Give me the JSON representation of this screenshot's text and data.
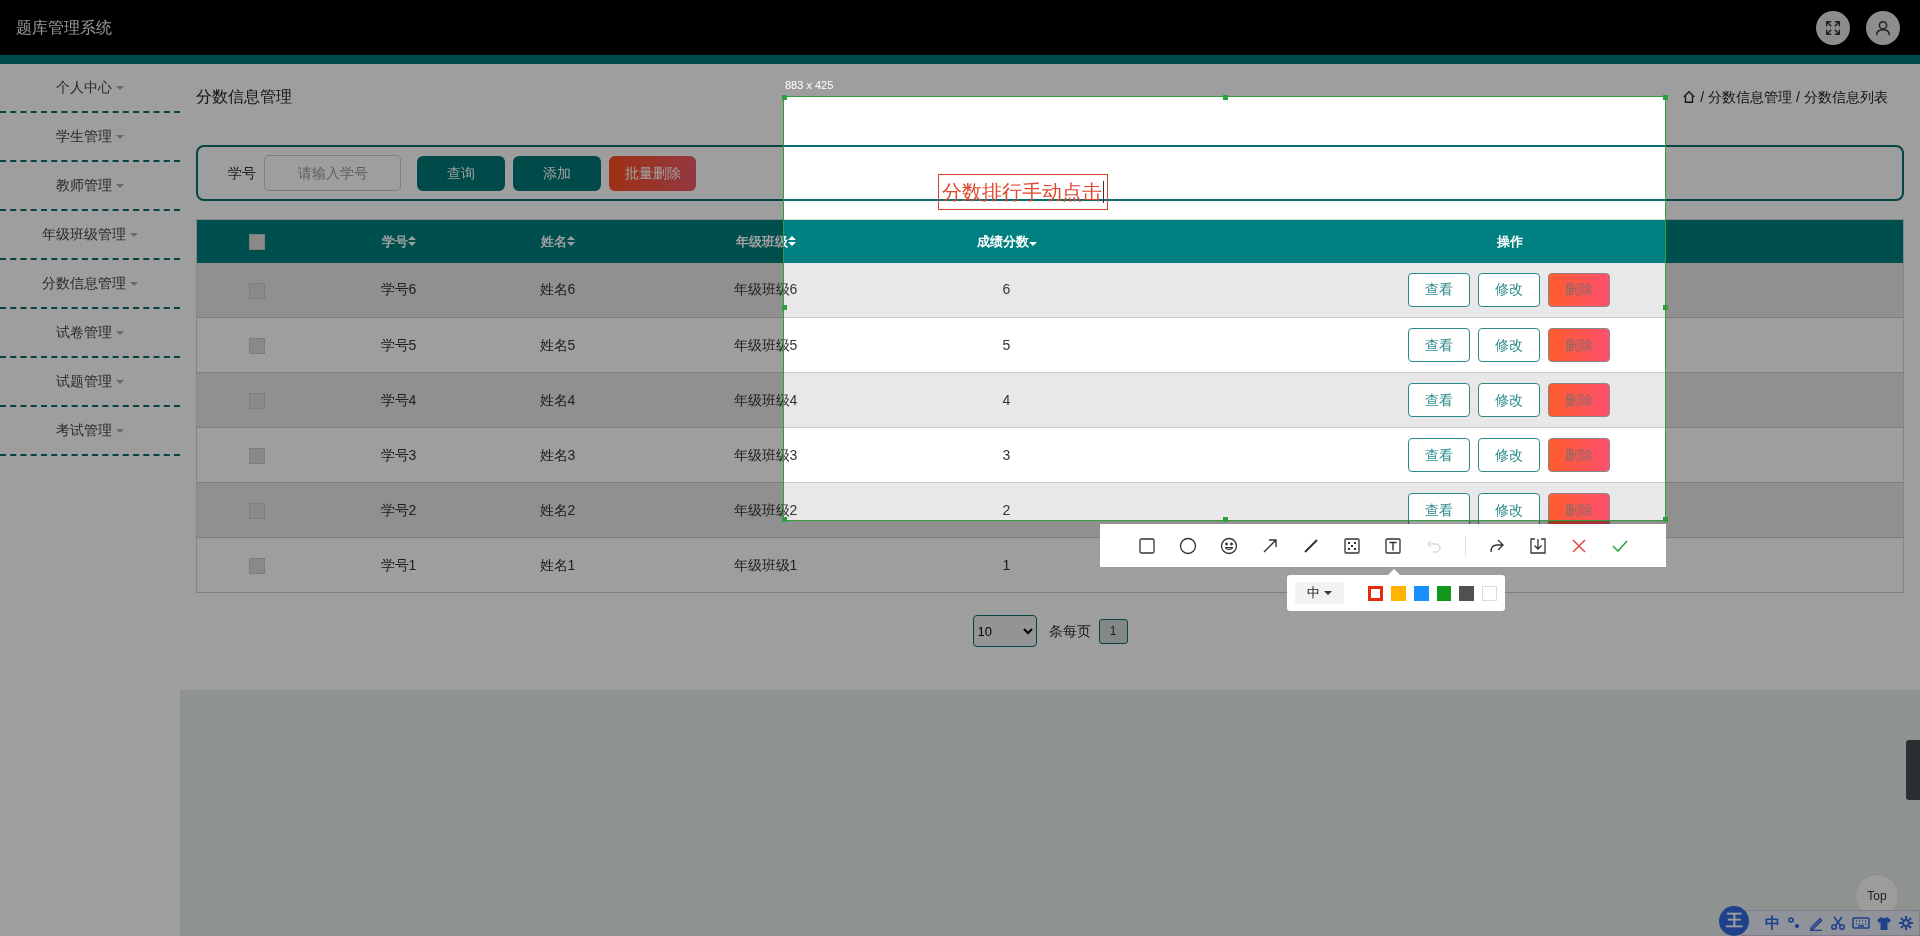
{
  "app": {
    "title": "题库管理系统"
  },
  "sidebar": {
    "items": [
      {
        "label": "个人中心"
      },
      {
        "label": "学生管理"
      },
      {
        "label": "教师管理"
      },
      {
        "label": "年级班级管理"
      },
      {
        "label": "分数信息管理"
      },
      {
        "label": "试卷管理"
      },
      {
        "label": "试题管理"
      },
      {
        "label": "考试管理"
      }
    ]
  },
  "page": {
    "title": "分数信息管理",
    "separator": "/",
    "breadcrumb": [
      "分数信息管理",
      "分数信息列表"
    ]
  },
  "search": {
    "label": "学号",
    "placeholder": "请输入学号",
    "buttons": [
      {
        "label": "查询",
        "kind": "primary"
      },
      {
        "label": "添加",
        "kind": "primary"
      },
      {
        "label": "批量删除",
        "kind": "danger"
      }
    ]
  },
  "table": {
    "select_all": {
      "checked": false
    },
    "columns": [
      {
        "label": "学号",
        "kind": "sortable"
      },
      {
        "label": "姓名",
        "kind": "sortable"
      },
      {
        "label": "年级班级",
        "kind": "sortable"
      },
      {
        "label": "成绩分数",
        "kind": "descending"
      },
      {
        "label": "操作",
        "kind": "plain"
      }
    ],
    "rows": [
      {
        "checked": false,
        "cells": [
          "学号6",
          "姓名6",
          "年级班级6",
          "6"
        ],
        "actions": [
          {
            "label": "查看",
            "kind": "outline"
          },
          {
            "label": "修改",
            "kind": "outline"
          },
          {
            "label": "删除",
            "kind": "danger"
          }
        ]
      },
      {
        "checked": false,
        "cells": [
          "学号5",
          "姓名5",
          "年级班级5",
          "5"
        ],
        "actions": [
          {
            "label": "查看",
            "kind": "outline"
          },
          {
            "label": "修改",
            "kind": "outline"
          },
          {
            "label": "删除",
            "kind": "danger"
          }
        ]
      },
      {
        "checked": false,
        "cells": [
          "学号4",
          "姓名4",
          "年级班级4",
          "4"
        ],
        "actions": [
          {
            "label": "查看",
            "kind": "outline"
          },
          {
            "label": "修改",
            "kind": "outline"
          },
          {
            "label": "删除",
            "kind": "danger"
          }
        ]
      },
      {
        "checked": false,
        "cells": [
          "学号3",
          "姓名3",
          "年级班级3",
          "3"
        ],
        "actions": [
          {
            "label": "查看",
            "kind": "outline"
          },
          {
            "label": "修改",
            "kind": "outline"
          },
          {
            "label": "删除",
            "kind": "danger"
          }
        ]
      },
      {
        "checked": false,
        "cells": [
          "学号2",
          "姓名2",
          "年级班级2",
          "2"
        ],
        "actions": [
          {
            "label": "查看",
            "kind": "outline"
          },
          {
            "label": "修改",
            "kind": "outline"
          },
          {
            "label": "删除",
            "kind": "danger"
          }
        ]
      },
      {
        "checked": false,
        "cells": [
          "学号1",
          "姓名1",
          "年级班级1",
          "1"
        ]
      }
    ]
  },
  "pagination": {
    "page_size": "10",
    "per_page_label": "条每页",
    "pages": [
      {
        "label": "1",
        "selected": true
      }
    ]
  },
  "capture": {
    "size_label": "883 x 425",
    "annotation": "分数排行手动点击",
    "font_size": "中",
    "tools": [
      {
        "kind": "rect",
        "disabled": false
      },
      {
        "kind": "circle",
        "disabled": false
      },
      {
        "kind": "emoji",
        "disabled": false
      },
      {
        "kind": "arrow",
        "disabled": false
      },
      {
        "kind": "line",
        "disabled": false
      },
      {
        "kind": "mosaic",
        "disabled": false
      },
      {
        "kind": "text",
        "disabled": false
      },
      {
        "kind": "undo",
        "disabled": true
      }
    ],
    "actions": [
      {
        "kind": "share"
      },
      {
        "kind": "download"
      },
      {
        "kind": "cancel"
      },
      {
        "kind": "confirm"
      }
    ],
    "colors": [
      {
        "color": "#e8290b",
        "selected": true
      },
      {
        "color": "#ffb400",
        "selected": false
      },
      {
        "color": "#1890ff",
        "selected": false
      },
      {
        "color": "#12961c",
        "selected": false
      },
      {
        "color": "#505050",
        "selected": false
      },
      {
        "color": "#ffffff",
        "selected": false
      }
    ]
  },
  "back_to_top": {
    "label": "Top"
  },
  "ime_bar": {
    "logo": "王",
    "mode": "中"
  }
}
